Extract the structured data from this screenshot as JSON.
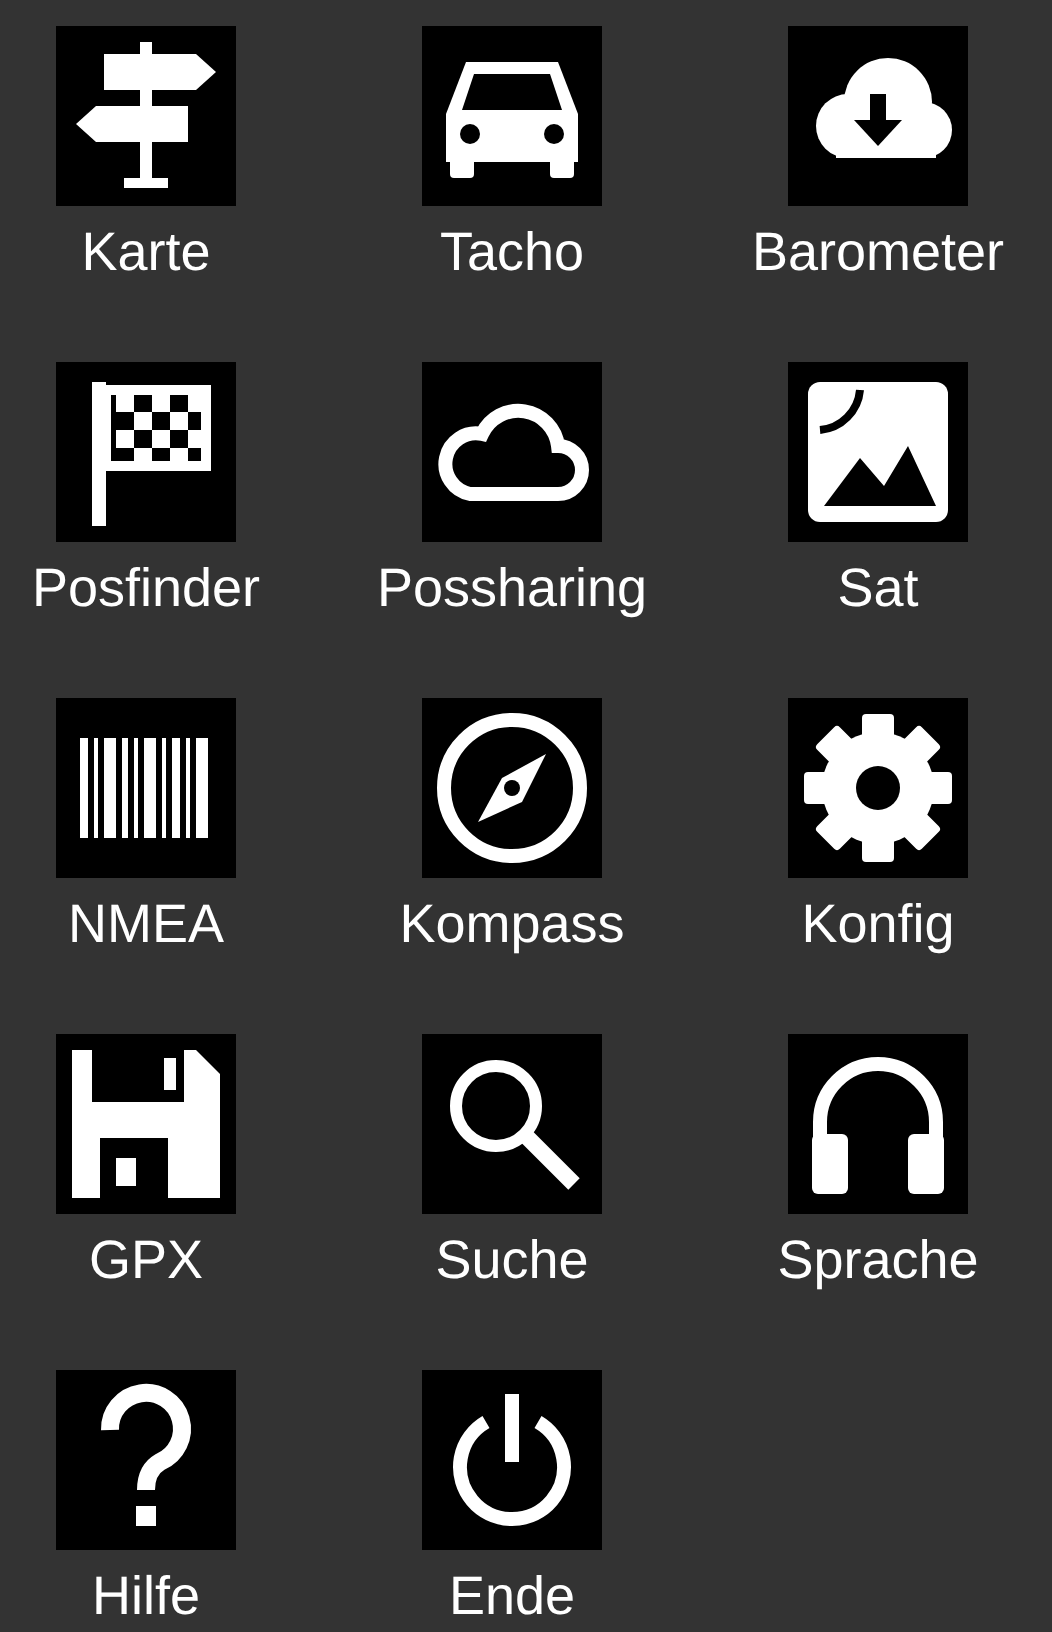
{
  "menu": [
    {
      "label": "Karte"
    },
    {
      "label": "Tacho"
    },
    {
      "label": "Barometer"
    },
    {
      "label": "Posfinder"
    },
    {
      "label": "Possharing"
    },
    {
      "label": "Sat"
    },
    {
      "label": "NMEA"
    },
    {
      "label": "Kompass"
    },
    {
      "label": "Konfig"
    },
    {
      "label": "GPX"
    },
    {
      "label": "Suche"
    },
    {
      "label": "Sprache"
    },
    {
      "label": "Hilfe"
    },
    {
      "label": "Ende"
    }
  ]
}
